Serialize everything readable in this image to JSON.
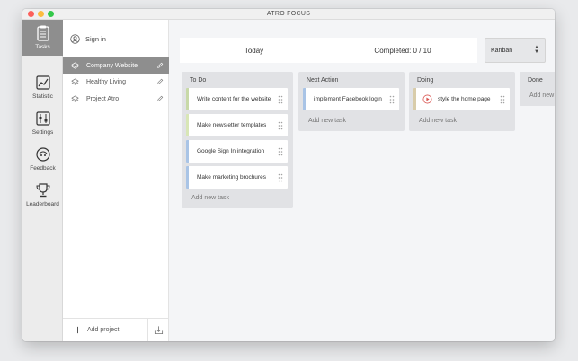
{
  "app": {
    "title": "ATRO FOCUS"
  },
  "nav": {
    "items": [
      {
        "label": "Tasks",
        "icon": "clipboard-icon",
        "active": true
      },
      {
        "label": "Statistic",
        "icon": "chart-icon",
        "active": false
      },
      {
        "label": "Settings",
        "icon": "settings-icon",
        "active": false
      },
      {
        "label": "Feedback",
        "icon": "feedback-icon",
        "active": false
      },
      {
        "label": "Leaderboard",
        "icon": "trophy-icon",
        "active": false
      }
    ]
  },
  "sidebar": {
    "signin_label": "Sign in",
    "projects": [
      {
        "label": "Company Website",
        "active": true
      },
      {
        "label": "Healthy Living",
        "active": false
      },
      {
        "label": "Project Atro",
        "active": false
      }
    ],
    "add_project_label": "Add project"
  },
  "topbar": {
    "today_label": "Today",
    "completed_label": "Completed: 0 / 10",
    "view_select": {
      "value": "Kanban"
    }
  },
  "board": {
    "add_task_label": "Add new task",
    "columns": [
      {
        "title": "To Do",
        "cards": [
          {
            "label": "Write content for the website",
            "accent": "#c8d9a8"
          },
          {
            "label": "Make newsletter templates",
            "accent": "#d8e6b6"
          },
          {
            "label": "Google Sign In integration",
            "accent": "#a9c4e6"
          },
          {
            "label": "Make marketing brochures",
            "accent": "#a9c4e6"
          }
        ]
      },
      {
        "title": "Next Action",
        "cards": [
          {
            "label": "implement Facebook login",
            "accent": "#a9c4e6"
          }
        ]
      },
      {
        "title": "Doing",
        "cards": [
          {
            "label": "style the home page",
            "accent": "#d8ccaa",
            "playing": true
          }
        ]
      },
      {
        "title": "Done",
        "cards": []
      }
    ]
  },
  "colors": {
    "accent_play": "#d9534f",
    "active_bg": "#8e8e8e"
  }
}
